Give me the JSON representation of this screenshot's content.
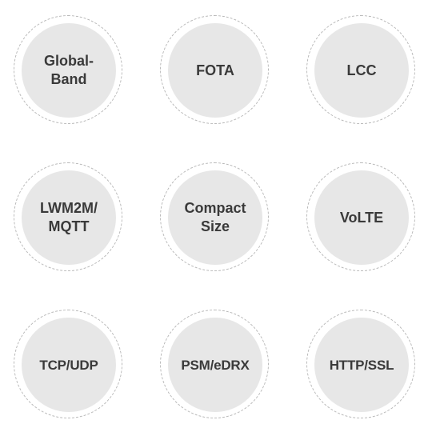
{
  "features": [
    {
      "label": "Global-\nBand"
    },
    {
      "label": "FOTA"
    },
    {
      "label": "LCC"
    },
    {
      "label": "LWM2M/\nMQTT"
    },
    {
      "label": "Compact\nSize"
    },
    {
      "label": "VoLTE"
    },
    {
      "label": "TCP/UDP"
    },
    {
      "label": "PSM/eDRX"
    },
    {
      "label": "HTTP/SSL"
    }
  ],
  "colors": {
    "disc": "#e7e7e7",
    "ring": "#b8b8b8",
    "text": "#3a3a3a"
  }
}
